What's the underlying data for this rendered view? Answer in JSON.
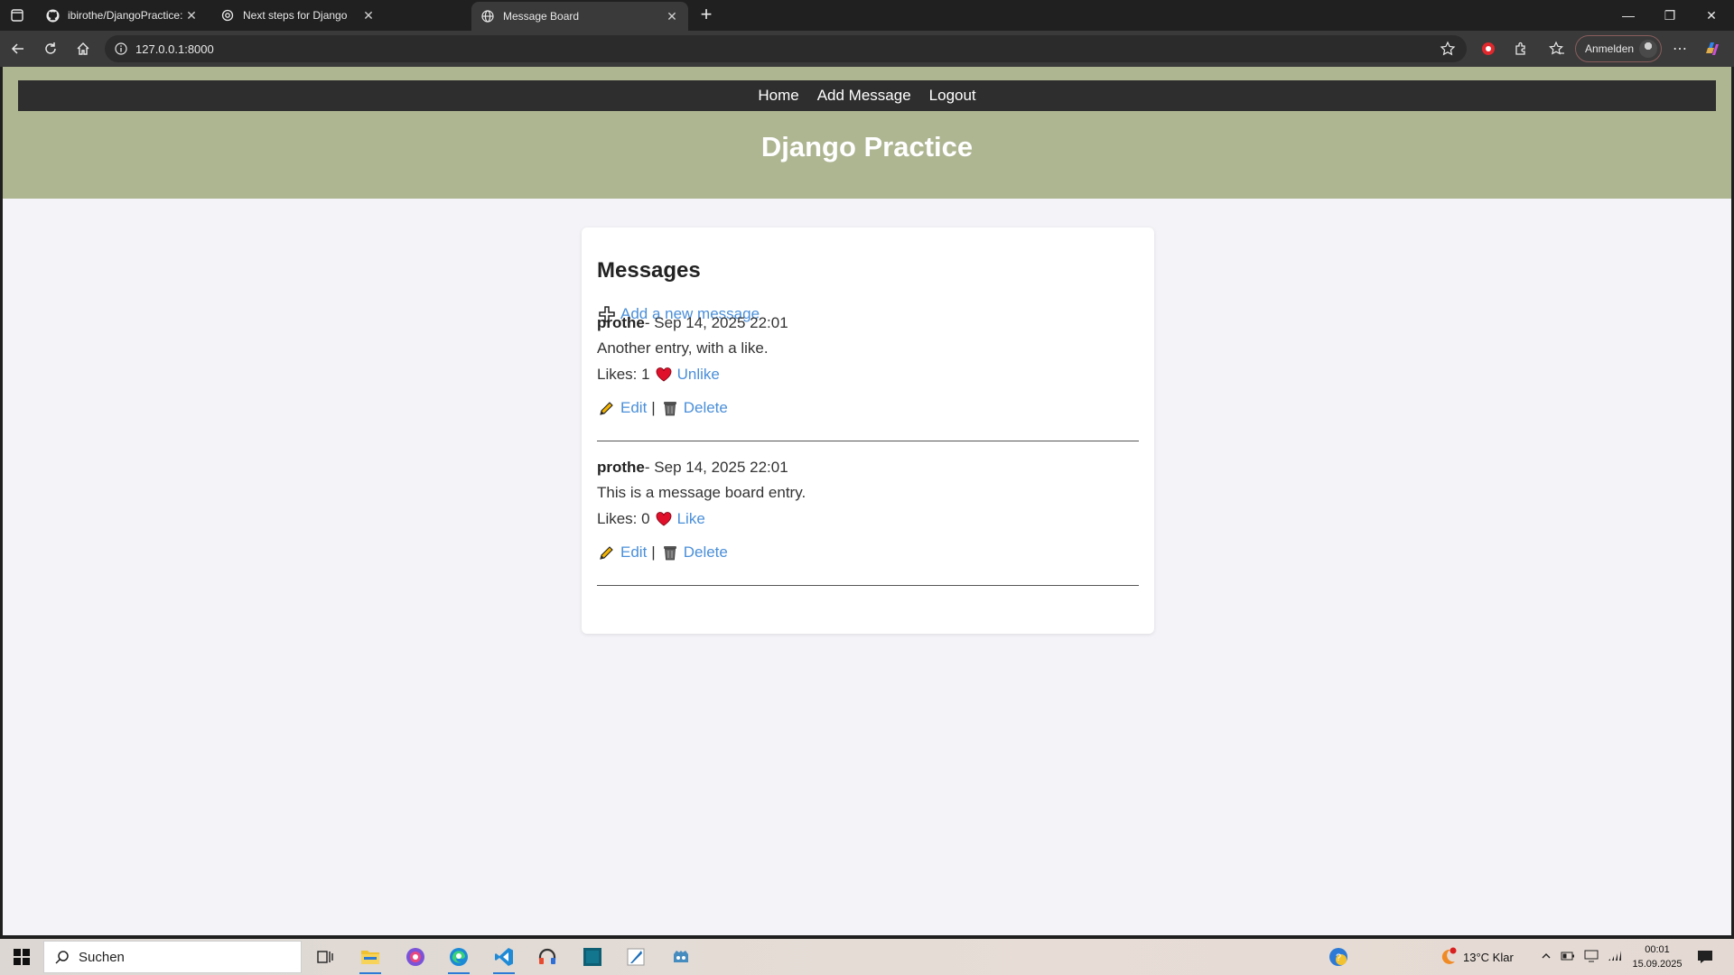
{
  "browser": {
    "tabs": [
      {
        "title": "ibirothe/DjangoPractice: Practice",
        "icon": "github-icon",
        "active": false
      },
      {
        "title": "Next steps for Django",
        "icon": "openai-icon",
        "active": false
      },
      {
        "title": "Message Board",
        "icon": "globe-icon",
        "active": true
      }
    ],
    "address": "127.0.0.1:8000",
    "signin_label": "Anmelden"
  },
  "site": {
    "nav": [
      "Home",
      "Add Message",
      "Logout"
    ],
    "title": "Django Practice"
  },
  "board": {
    "heading": "Messages",
    "add_link": "Add a new message",
    "messages": [
      {
        "author": "prothe",
        "date_text": " - Sep 14, 2025 22:01",
        "body": "Another entry, with a like.",
        "likes_text": "Likes: 1",
        "like_action": "Unlike",
        "edit": "Edit",
        "sep": "|",
        "delete": "Delete"
      },
      {
        "author": "prothe",
        "date_text": " - Sep 14, 2025 22:01",
        "body": "This is a message board entry.",
        "likes_text": "Likes: 0",
        "like_action": "Like",
        "edit": "Edit",
        "sep": "|",
        "delete": "Delete"
      }
    ]
  },
  "taskbar": {
    "search_placeholder": "Suchen",
    "weather": "13°C  Klar",
    "time": "00:01",
    "date": "15.09.2025"
  },
  "colors": {
    "header_bg": "#adb591",
    "nav_bg": "#2e2e2e",
    "link": "#4a8fd9",
    "page_bg": "#f4f4f8"
  }
}
